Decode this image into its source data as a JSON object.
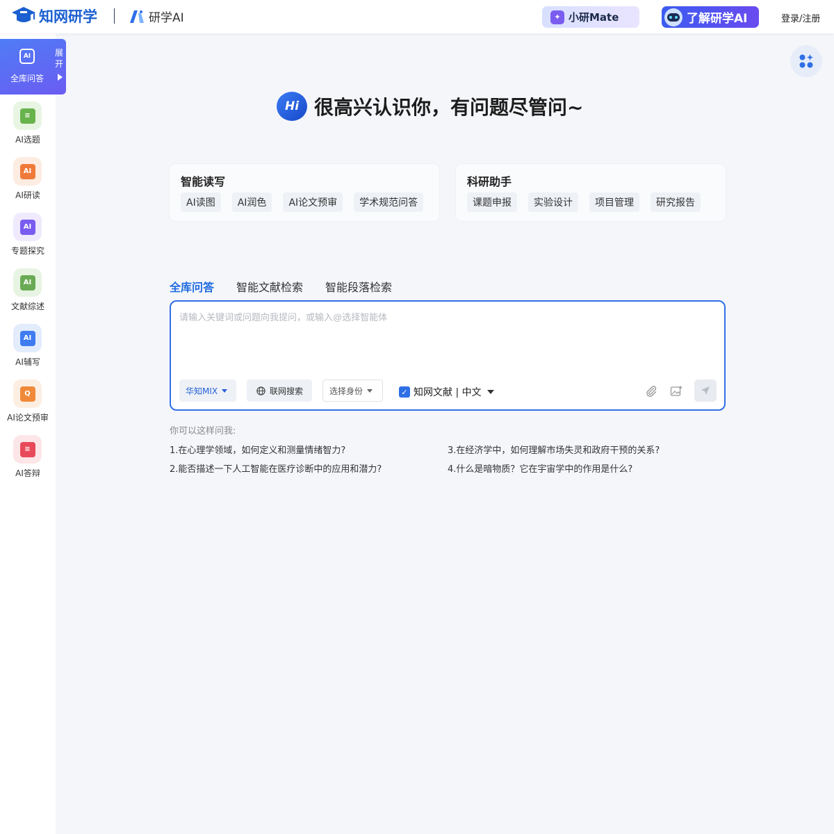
{
  "header": {
    "logo_text": "知网研学",
    "brand2_text": "研学AI",
    "mate_label": "小研Mate",
    "learn_label": "了解研学AI",
    "login_label": "登录/注册"
  },
  "sidebar": {
    "active": {
      "icon_text": "AI",
      "label": "全库问答",
      "expand_label": "展开"
    },
    "items": [
      {
        "label": "AI选题",
        "icon_color": "#69b34c",
        "bg": "#e8f5e3",
        "icon_text": "≡"
      },
      {
        "label": "AI研读",
        "icon_color": "#f07a3a",
        "bg": "#fdece2",
        "icon_text": "AI"
      },
      {
        "label": "专题探究",
        "icon_color": "#7a5cf0",
        "bg": "#efeafd",
        "icon_text": "AI"
      },
      {
        "label": "文献综述",
        "icon_color": "#6aaa55",
        "bg": "#e8f4e3",
        "icon_text": "AI"
      },
      {
        "label": "AI辅写",
        "icon_color": "#3f7cf0",
        "bg": "#e3ecfd",
        "icon_text": "AI"
      },
      {
        "label": "AI论文预审",
        "icon_color": "#f08a3a",
        "bg": "#fdeee2",
        "icon_text": "Q"
      },
      {
        "label": "AI答辩",
        "icon_color": "#e84a5a",
        "bg": "#fde6e8",
        "icon_text": "≡"
      }
    ]
  },
  "greeting": {
    "badge": "Hi",
    "text": "很高兴认识你，有问题尽管问~"
  },
  "cards": [
    {
      "title": "智能读写",
      "chips": [
        "AI读图",
        "AI润色",
        "AI论文预审",
        "学术规范问答"
      ]
    },
    {
      "title": "科研助手",
      "chips": [
        "课题申报",
        "实验设计",
        "项目管理",
        "研究报告"
      ]
    }
  ],
  "tabs": [
    "全库问答",
    "智能文献检索",
    "智能段落检索"
  ],
  "input": {
    "placeholder": "请输入关键词或问题向我提问，或输入@选择智能体",
    "value": "",
    "model": "华知MIX",
    "web_search": "联网搜索",
    "role": "选择身份",
    "source": "知网文献 | 中文",
    "source_checked": true
  },
  "suggestions": {
    "title": "你可以这样问我:",
    "items": [
      "1.在心理学领域，如何定义和测量情绪智力?",
      "2.能否描述一下人工智能在医疗诊断中的应用和潜力?",
      "3.在经济学中，如何理解市场失灵和政府干预的关系?",
      "4.什么是暗物质？它在宇宙学中的作用是什么?"
    ]
  },
  "colors": {
    "accent": "#2f6fe6",
    "brand": "#1a5fd0",
    "page_bg": "#f4f6fa"
  }
}
